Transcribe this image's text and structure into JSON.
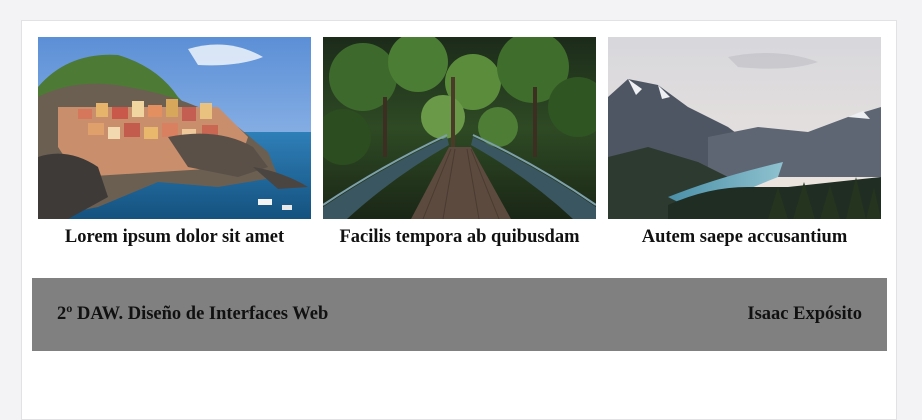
{
  "cards": [
    {
      "caption": "Lorem ipsum dolor sit amet",
      "image": "coastal-village-photo"
    },
    {
      "caption": "Facilis tempora ab quibusdam",
      "image": "forest-bridge-photo"
    },
    {
      "caption": "Autem saepe accusantium",
      "image": "mountain-lake-photo"
    }
  ],
  "footer": {
    "left_text": "2º DAW. Diseño de Interfaces Web",
    "right_text": "Isaac Expósito"
  },
  "colors": {
    "page_bg": "#f3f3f5",
    "content_bg": "#ffffff",
    "footer_bg": "#808080",
    "text": "#111111"
  }
}
